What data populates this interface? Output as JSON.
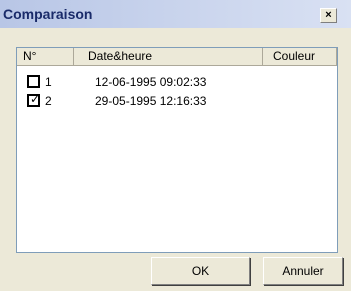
{
  "window": {
    "title": "Comparaison",
    "close_glyph": "×"
  },
  "list": {
    "columns": [
      "N°",
      "Date&heure",
      "Couleur"
    ],
    "rows": [
      {
        "number": "1",
        "datetime": "12-06-1995 09:02:33",
        "checked": false
      },
      {
        "number": "2",
        "datetime": "29-05-1995 12:16:33",
        "checked": true
      }
    ]
  },
  "buttons": {
    "ok": "OK",
    "cancel": "Annuler"
  },
  "check_glyph": "✓"
}
